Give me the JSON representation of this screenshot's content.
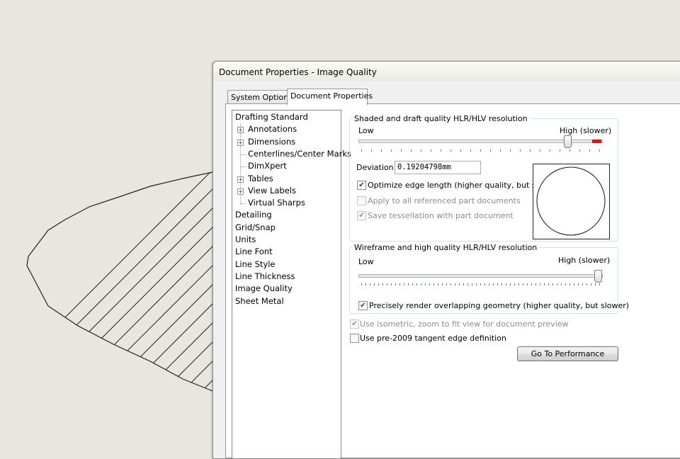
{
  "dialog": {
    "title": "Document Properties - Image Quality",
    "tabs": [
      {
        "label": "System Options"
      },
      {
        "label": "Document Properties"
      }
    ]
  },
  "tree": {
    "items": [
      {
        "label": "Drafting Standard",
        "level": 0,
        "expandable": false
      },
      {
        "label": "Annotations",
        "level": 1,
        "expandable": true
      },
      {
        "label": "Dimensions",
        "level": 1,
        "expandable": true
      },
      {
        "label": "Centerlines/Center Marks",
        "level": 1,
        "expandable": false
      },
      {
        "label": "DimXpert",
        "level": 1,
        "expandable": false
      },
      {
        "label": "Tables",
        "level": 1,
        "expandable": true
      },
      {
        "label": "View Labels",
        "level": 1,
        "expandable": true
      },
      {
        "label": "Virtual Sharps",
        "level": 1,
        "expandable": false
      },
      {
        "label": "Detailing",
        "level": 0,
        "expandable": false
      },
      {
        "label": "Grid/Snap",
        "level": 0,
        "expandable": false
      },
      {
        "label": "Units",
        "level": 0,
        "expandable": false
      },
      {
        "label": "Line Font",
        "level": 0,
        "expandable": false
      },
      {
        "label": "Line Style",
        "level": 0,
        "expandable": false
      },
      {
        "label": "Line Thickness",
        "level": 0,
        "expandable": false
      },
      {
        "label": "Image Quality",
        "level": 0,
        "expandable": false,
        "selected": true
      },
      {
        "label": "Sheet Metal",
        "level": 0,
        "expandable": false
      }
    ]
  },
  "shaded": {
    "group_label": "Shaded and draft quality HLR/HLV resolution",
    "low_label": "Low",
    "high_label": "High (slower)",
    "slider_value": 0.86,
    "deviation_label": "Deviation:",
    "deviation_value": "0.19204798mm",
    "optimize": {
      "label": "Optimize edge length (higher quality, but slower)",
      "checked": true,
      "enabled": true
    },
    "apply_all": {
      "label": "Apply to all referenced part documents",
      "checked": false,
      "enabled": false
    },
    "save_tess": {
      "label": "Save tessellation with part document",
      "checked": true,
      "enabled": false
    }
  },
  "wireframe": {
    "group_label": "Wireframe and high quality HLR/HLV resolution",
    "low_label": "Low",
    "high_label": "High (slower)",
    "slider_value": 1.0,
    "precise": {
      "label": "Precisely render overlapping geometry (higher quality, but slower)",
      "checked": true,
      "enabled": true
    }
  },
  "options": {
    "isometric": {
      "label": "Use isometric, zoom to fit view for document preview",
      "checked": true,
      "enabled": false
    },
    "pre2009": {
      "label": "Use pre-2009 tangent edge definition",
      "checked": false,
      "enabled": true
    }
  },
  "performance_button": "Go To Performance",
  "colors": {
    "accent_red": "#e01010",
    "check_mark": "#213d8c",
    "background": "#e7e7df"
  }
}
